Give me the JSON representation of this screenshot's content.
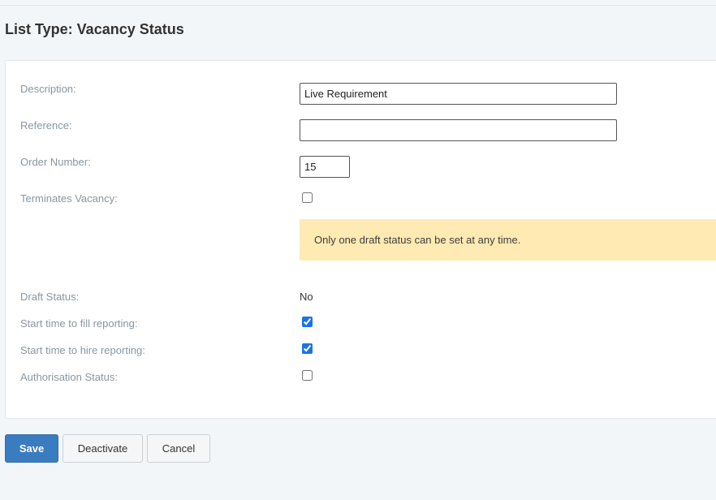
{
  "page": {
    "title": "List Type: Vacancy Status"
  },
  "form": {
    "description": {
      "label": "Description:",
      "value": "Live Requirement"
    },
    "reference": {
      "label": "Reference:",
      "value": ""
    },
    "order_number": {
      "label": "Order Number:",
      "value": "15"
    },
    "terminates_vacancy": {
      "label": "Terminates Vacancy:",
      "checked": false
    },
    "notice": "Only one draft status can be set at any time.",
    "draft_status": {
      "label": "Draft Status:",
      "value": "No"
    },
    "start_time_fill": {
      "label": "Start time to fill reporting:",
      "checked": true
    },
    "start_time_hire": {
      "label": "Start time to hire reporting:",
      "checked": true
    },
    "authorisation_status": {
      "label": "Authorisation Status:",
      "checked": false
    }
  },
  "actions": {
    "save": "Save",
    "deactivate": "Deactivate",
    "cancel": "Cancel"
  },
  "colors": {
    "primary": "#3a7cc0",
    "notice_bg": "#ffeab3",
    "checkbox_accent": "#1a73e8"
  }
}
